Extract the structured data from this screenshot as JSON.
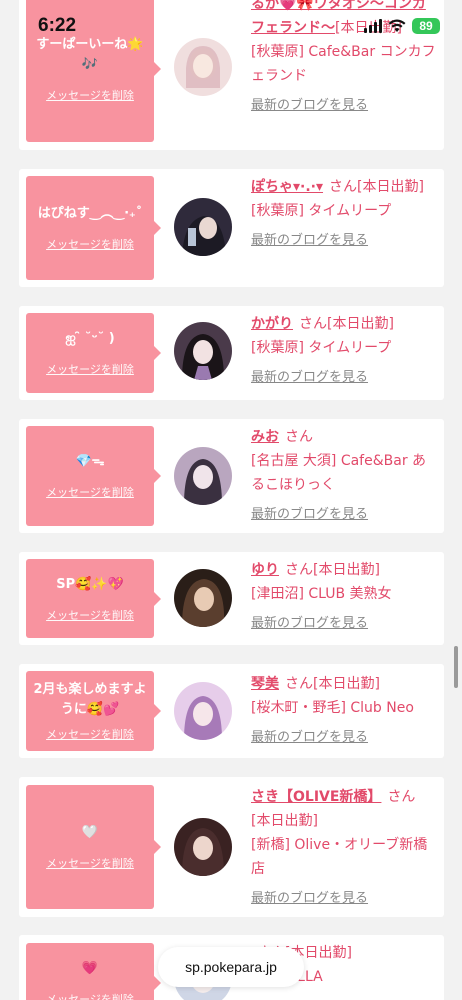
{
  "status_bar": {
    "time": "6:22",
    "battery": "89"
  },
  "url": "sp.pokepara.jp",
  "delete_label": "メッセージを削除",
  "blog_label": "最新のブログを見る",
  "san_label": "さん",
  "cards": [
    {
      "message": "すーぱーいーね🌟🎶",
      "name": "るか💗🎀ワタオシ〜コンカフェランド〜",
      "status": "[本日出勤]",
      "shop": "[秋葉原] Cafe&Bar コンカフェランド",
      "avatar_color": "#e9c9c9"
    },
    {
      "message": "はぴねす‿︵‿‧₊˚",
      "name": "ぽちゃ▾·.·▾",
      "status": "[本日出勤]",
      "shop": "[秋葉原] タイムリープ",
      "avatar_color": "#2f2a3b"
    },
    {
      "message": "ஐ ̑̑ ˘ᵕ˘ )",
      "name": "かがり",
      "status": "[本日出勤]",
      "shop": "[秋葉原] タイムリープ",
      "avatar_color": "#3b3042"
    },
    {
      "message": "💎ᯓ",
      "name": "みお",
      "status": "",
      "shop": "[名古屋 大須] Cafe&Bar あるこほりっく",
      "avatar_color": "#b9a6bf"
    },
    {
      "message": "SP🥰✨💖",
      "name": "ゆり",
      "status": "[本日出勤]",
      "shop": "[津田沼] CLUB 美熟女",
      "avatar_color": "#5a3e2e"
    },
    {
      "message": "2月も楽しめますように🥰💕",
      "name": "琴美",
      "status": "[本日出勤]",
      "shop": "[桜木町・野毛] Club Neo",
      "avatar_color": "#d9b7e6"
    },
    {
      "message": "🤍",
      "name": "さき【OLIVE新橋】",
      "status": "[本日出勤]",
      "shop": "[新橋] Olive・オリーブ新橋店",
      "avatar_color": "#4a2d2d"
    },
    {
      "message": "💗",
      "name": "",
      "status": "[本日出勤]",
      "shop": "VALHALLA",
      "avatar_color": "#cfd6e6"
    }
  ]
}
